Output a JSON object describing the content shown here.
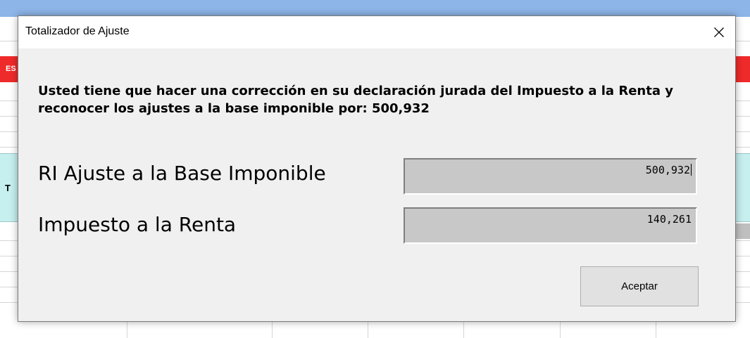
{
  "background_sheet": {
    "titlebar_color": "#8db5e8",
    "red_band_text": "ES",
    "cyan_band_text": "T",
    "red_color": "#ef2a2a",
    "cyan_color": "#c6efef"
  },
  "dialog": {
    "title": "Totalizador de Ajuste",
    "close_icon": "close-icon",
    "message": "Usted tiene que hacer una corrección en su declaración jurada del Impuesto a la Renta y reconocer los ajustes a la base imponible por: 500,932",
    "fields": [
      {
        "label": "RI Ajuste a la Base Imponible",
        "value": "500,932"
      },
      {
        "label": "Impuesto a la Renta",
        "value": "140,261"
      }
    ],
    "ok_label": "Aceptar"
  }
}
